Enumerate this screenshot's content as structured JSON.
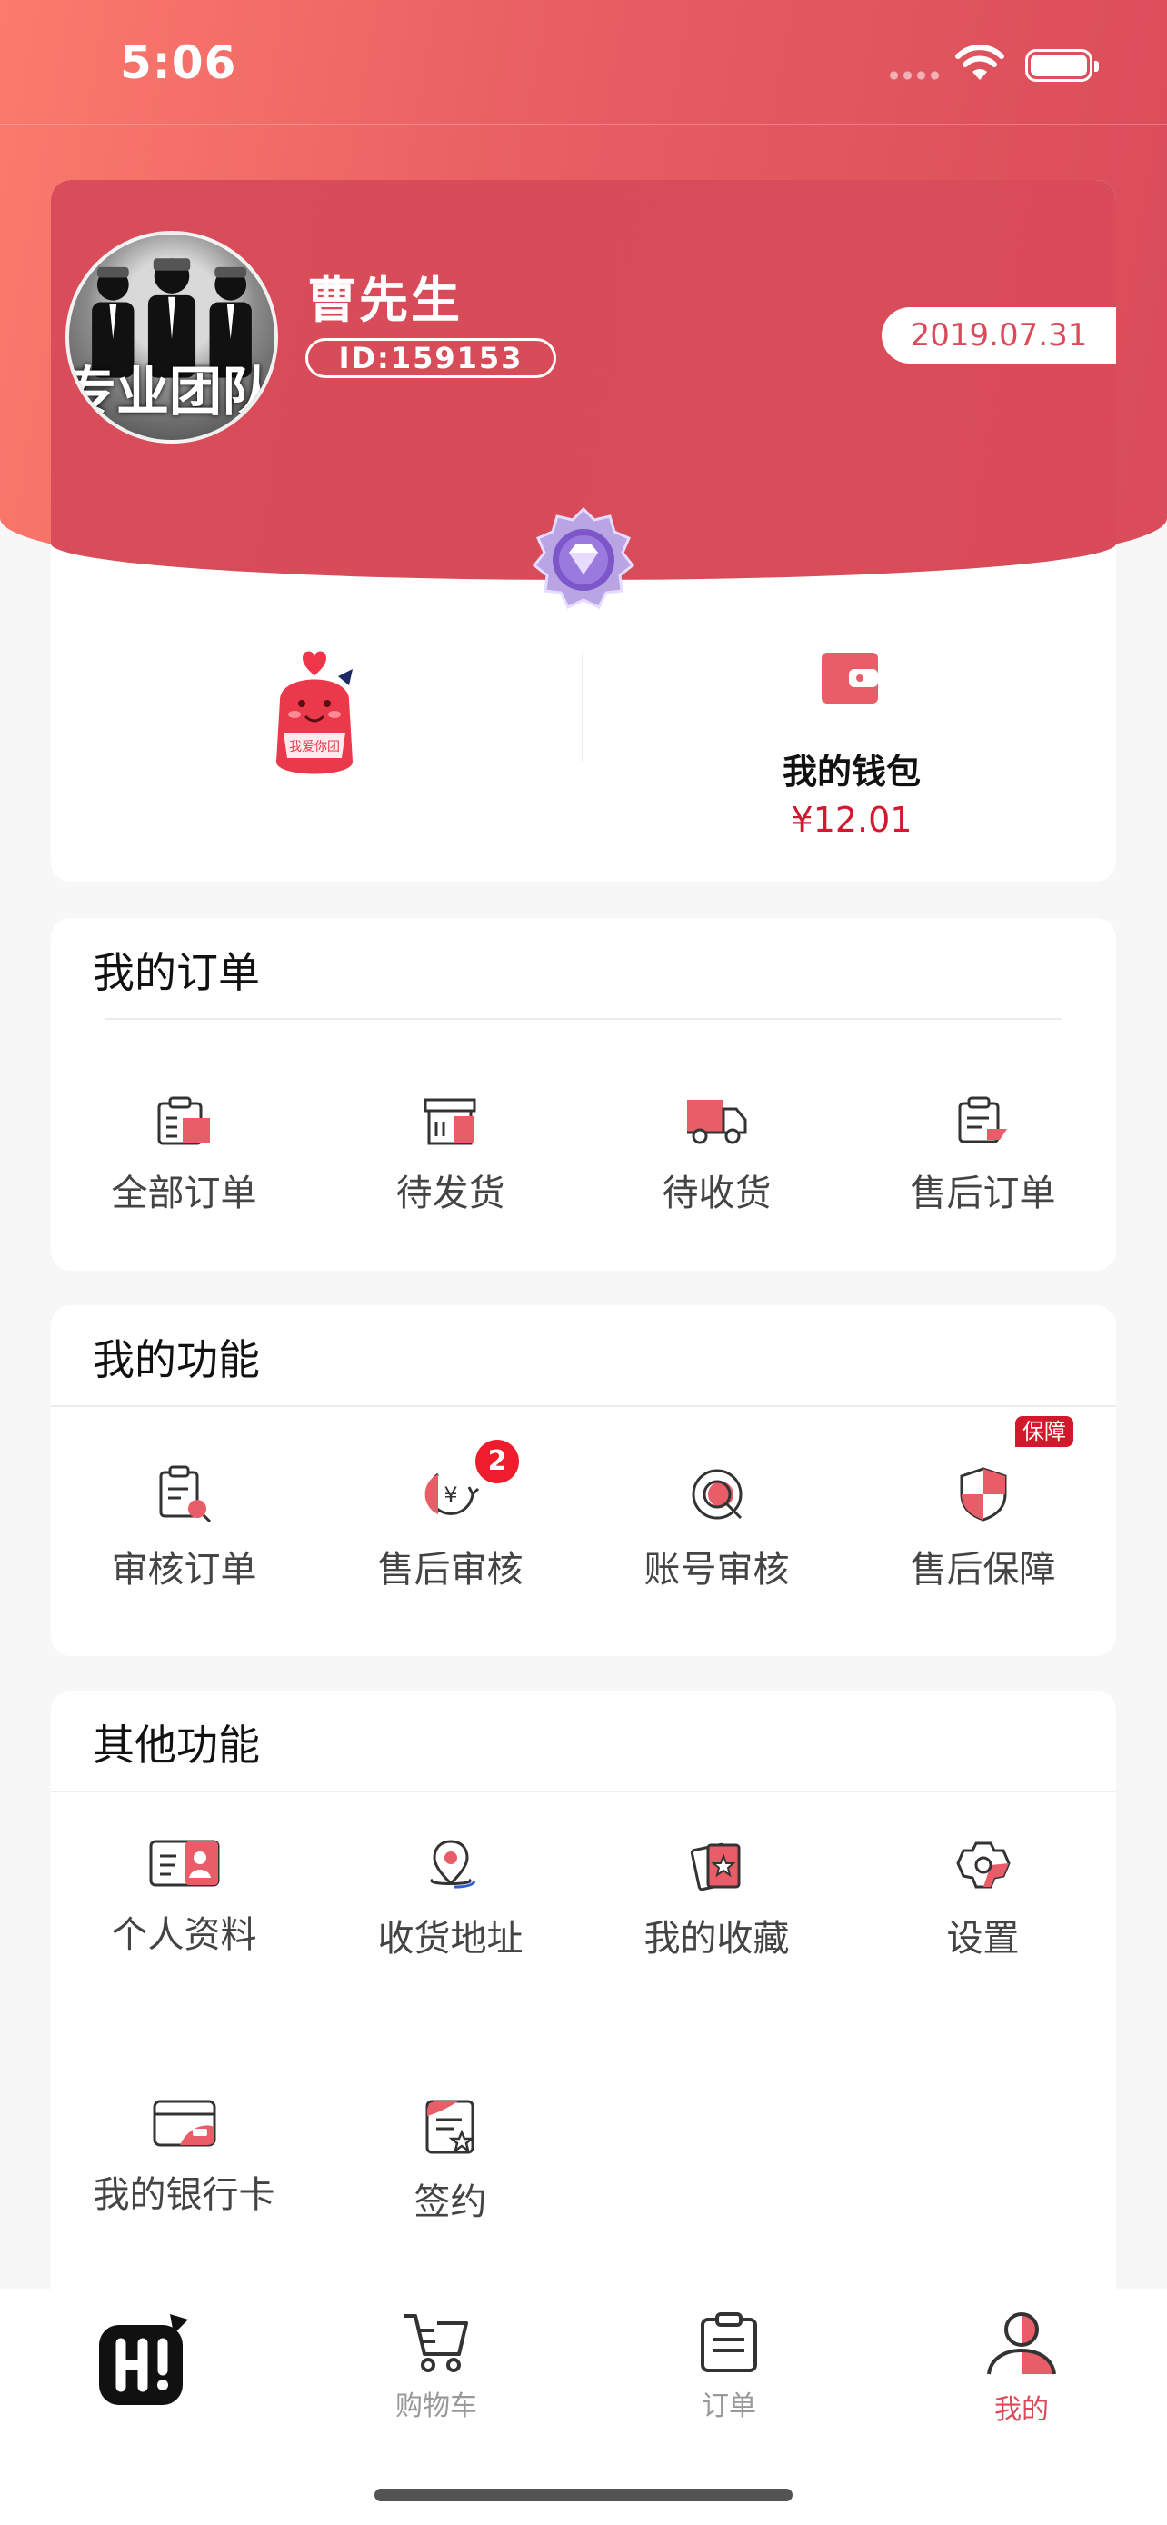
{
  "status": {
    "time": "5:06"
  },
  "profile": {
    "avatar_caption": "专业团队",
    "name": "曹先生",
    "id": "ID:159153",
    "date": "2019.07.31"
  },
  "wallet": {
    "label": "我的钱包",
    "amount": "¥12.01"
  },
  "orders": {
    "title": "我的订单",
    "items": [
      {
        "label": "全部订单",
        "icon": "all-orders-icon"
      },
      {
        "label": "待发货",
        "icon": "to-ship-icon"
      },
      {
        "label": "待收货",
        "icon": "delivery-truck-icon"
      },
      {
        "label": "售后订单",
        "icon": "aftersale-order-icon"
      }
    ]
  },
  "functions": {
    "title": "我的功能",
    "items": [
      {
        "label": "审核订单",
        "icon": "review-order-icon"
      },
      {
        "label": "售后审核",
        "icon": "yuan-return-icon",
        "badge": "2"
      },
      {
        "label": "账号审核",
        "icon": "account-review-icon"
      },
      {
        "label": "售后保障",
        "icon": "shield-icon",
        "tag": "保障"
      }
    ]
  },
  "others": {
    "title": "其他功能",
    "items": [
      {
        "label": "个人资料",
        "icon": "id-card-icon"
      },
      {
        "label": "收货地址",
        "icon": "location-pin-icon"
      },
      {
        "label": "我的收藏",
        "icon": "favorites-icon"
      },
      {
        "label": "设置",
        "icon": "settings-gear-icon"
      },
      {
        "label": "我的银行卡",
        "icon": "bank-card-icon"
      },
      {
        "label": "签约",
        "icon": "contract-icon"
      }
    ]
  },
  "tabbar": {
    "items": [
      {
        "label": "",
        "icon": "app-logo-icon"
      },
      {
        "label": "购物车",
        "icon": "cart-icon"
      },
      {
        "label": "订单",
        "icon": "order-list-icon"
      },
      {
        "label": "我的",
        "icon": "profile-icon",
        "active": true
      }
    ]
  },
  "colors": {
    "primary": "#d94b59",
    "price": "#d11a2f",
    "badge": "#ee1c2c"
  }
}
